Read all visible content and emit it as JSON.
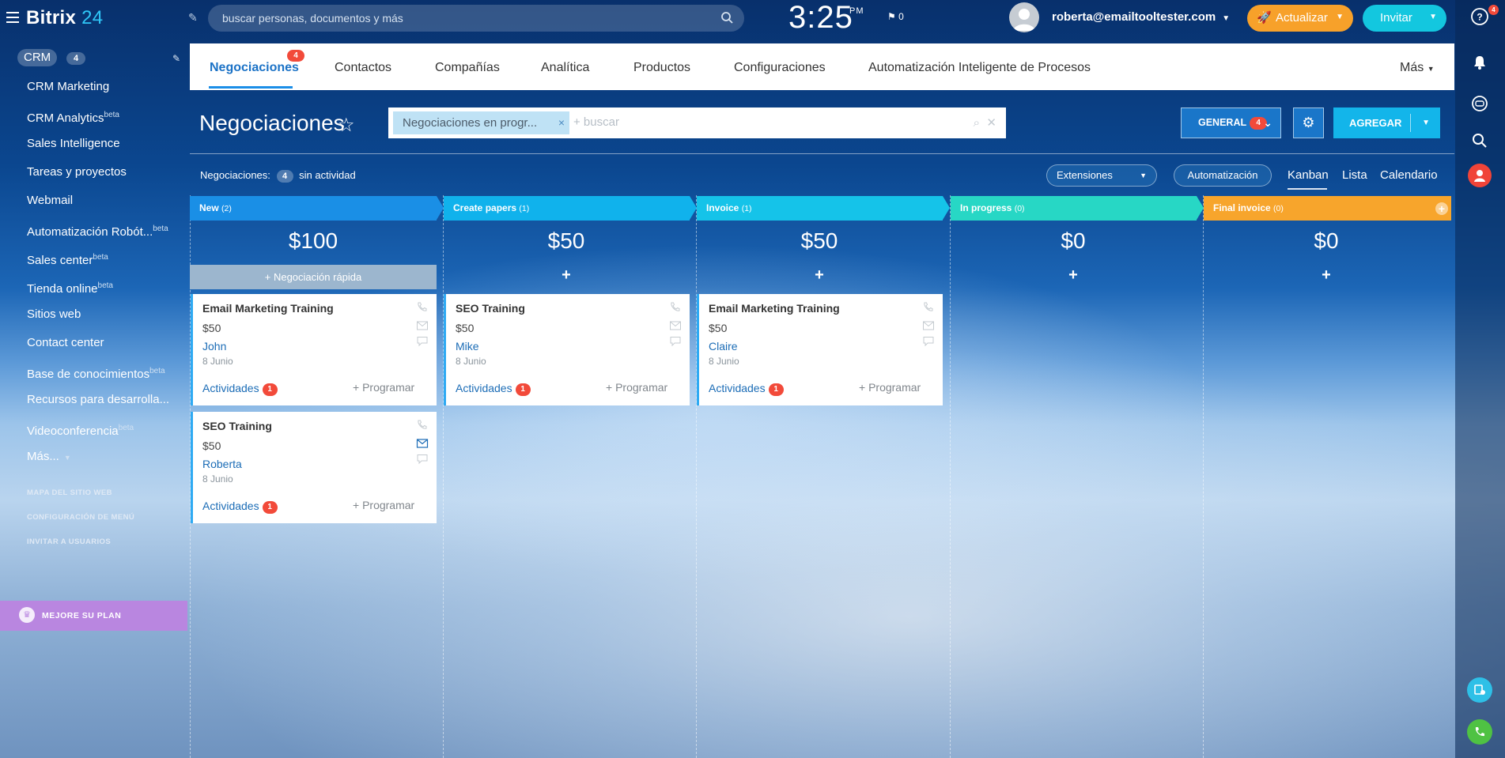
{
  "header": {
    "logo_text": "Bitrix",
    "logo_num": "24",
    "search_placeholder": "buscar personas, documentos y más",
    "time": "3:25",
    "ampm": "PM",
    "flag_count": "0",
    "user_email": "roberta@emailtooltester.com",
    "update_label": "Actualizar",
    "invite_label": "Invitar"
  },
  "sidebar": {
    "crm_label": "CRM",
    "crm_count": "4",
    "items": [
      {
        "label": "CRM Marketing",
        "sup": ""
      },
      {
        "label": "CRM Analytics",
        "sup": "beta"
      },
      {
        "label": "Sales Intelligence",
        "sup": ""
      },
      {
        "label": "Tareas y proyectos",
        "sup": ""
      },
      {
        "label": "Webmail",
        "sup": ""
      },
      {
        "label": "Automatización Robót...",
        "sup": "beta"
      },
      {
        "label": "Sales center",
        "sup": "beta"
      },
      {
        "label": "Tienda online",
        "sup": "beta"
      },
      {
        "label": "Sitios web",
        "sup": ""
      },
      {
        "label": "Contact center",
        "sup": ""
      },
      {
        "label": "Base de conocimientos",
        "sup": "beta"
      },
      {
        "label": "Recursos para desarrolla...",
        "sup": ""
      },
      {
        "label": "Videoconferencia",
        "sup": "beta"
      },
      {
        "label": "Más...",
        "sup": ""
      }
    ],
    "small_links": [
      "MAPA DEL SITIO WEB",
      "CONFIGURACIÓN DE MENÚ",
      "INVITAR A USUARIOS"
    ],
    "plan_label": "MEJORE SU PLAN"
  },
  "right_rail": {
    "help_badge": "4"
  },
  "tabs": {
    "items": [
      "Negociaciones",
      "Contactos",
      "Compañías",
      "Analítica",
      "Productos",
      "Configuraciones",
      "Automatización Inteligente de Procesos"
    ],
    "active_badge": "4",
    "more_label": "Más"
  },
  "toolbar": {
    "page_title": "Negociaciones",
    "filter_chip": "Negociaciones en progr...",
    "filter_placeholder": "+ buscar",
    "general_label": "GENERAL",
    "general_badge": "4",
    "add_label": "AGREGAR"
  },
  "subbar": {
    "count_prefix": "Negociaciones:",
    "count_value": "4",
    "count_suffix": "sin actividad",
    "extensions_label": "Extensiones",
    "automation_label": "Automatización",
    "views": [
      "Kanban",
      "Lista",
      "Calendario"
    ]
  },
  "kanban": {
    "quick_deal_label": "+ Negociación rápida",
    "stages": [
      {
        "name": "New",
        "count": "(2)",
        "sum": "$100",
        "color": "#1a8fe6"
      },
      {
        "name": "Create papers",
        "count": "(1)",
        "sum": "$50",
        "color": "#10b2ec"
      },
      {
        "name": "Invoice",
        "count": "(1)",
        "sum": "$50",
        "color": "#15c3e9"
      },
      {
        "name": "In progress",
        "count": "(0)",
        "sum": "$0",
        "color": "#27d7c5"
      },
      {
        "name": "Final invoice",
        "count": "(0)",
        "sum": "$0",
        "color": "#f7a52c"
      }
    ],
    "cards": [
      {
        "title": "Email Marketing Training",
        "price": "$50",
        "contact": "John",
        "date": "8 Junio",
        "activities": "Actividades",
        "activities_count": "1",
        "schedule": "+ Programar"
      },
      {
        "title": "SEO Training",
        "price": "$50",
        "contact": "Roberta",
        "date": "8 Junio",
        "activities": "Actividades",
        "activities_count": "1",
        "schedule": "+ Programar"
      },
      {
        "title": "SEO Training",
        "price": "$50",
        "contact": "Mike",
        "date": "8 Junio",
        "activities": "Actividades",
        "activities_count": "1",
        "schedule": "+ Programar"
      },
      {
        "title": "Email Marketing Training",
        "price": "$50",
        "contact": "Claire",
        "date": "8 Junio",
        "activities": "Actividades",
        "activities_count": "1",
        "schedule": "+ Programar"
      }
    ]
  }
}
